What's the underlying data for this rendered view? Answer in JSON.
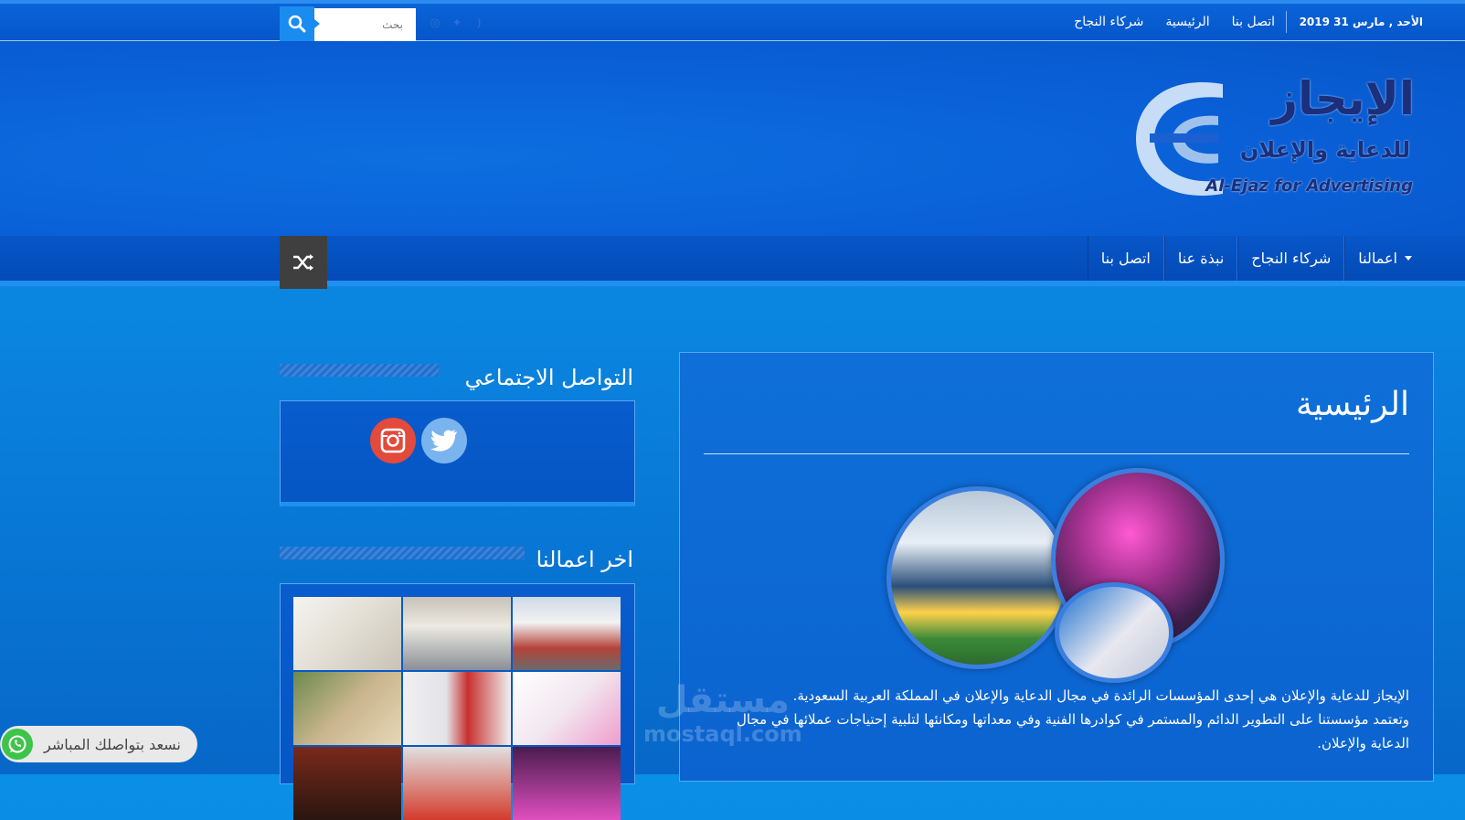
{
  "topbar": {
    "date": "الأحد , مارس 31 2019",
    "nav": [
      "اتصل بنا",
      "الرئيسية",
      "شركاء النجاح"
    ],
    "search_placeholder": "بحث"
  },
  "logo": {
    "arabic": "الإيجاز",
    "arabic_sub": "للدعاية والإعلان",
    "english": "Al-Ejaz for Advertising"
  },
  "mainnav": {
    "items": [
      "اعمالنا",
      "شركاء النجاح",
      "نبذة عنا",
      "اتصل بنا"
    ]
  },
  "content": {
    "title": "الرئيسية",
    "para1": "الإيجاز للدعاية والإعلان هي إحدى المؤسسات الرائدة في مجال الدعاية والإعلان في المملكة العربية السعودية.",
    "para2": "وتعتمد مؤسستنا على التطوير الدائم والمستمر في كوادرها الفنية وفي معداتها ومكانئها لتلبية إحتياجات عملائها في مجال الدعاية والإعلان."
  },
  "sidebar": {
    "social_title": "التواصل الاجتماعي",
    "works_title": "اخر اعمالنا"
  },
  "whatsapp": {
    "label": "نسعد بتواصلك المباشر"
  },
  "watermark": {
    "ar": "مستقل",
    "en": "mostaql.com"
  },
  "colors": {
    "brand": "#0756c8",
    "accent": "#1a8cf0",
    "twitter": "#7ab4ef",
    "instagram": "#e24a3c",
    "whatsapp": "#3ec34b"
  }
}
